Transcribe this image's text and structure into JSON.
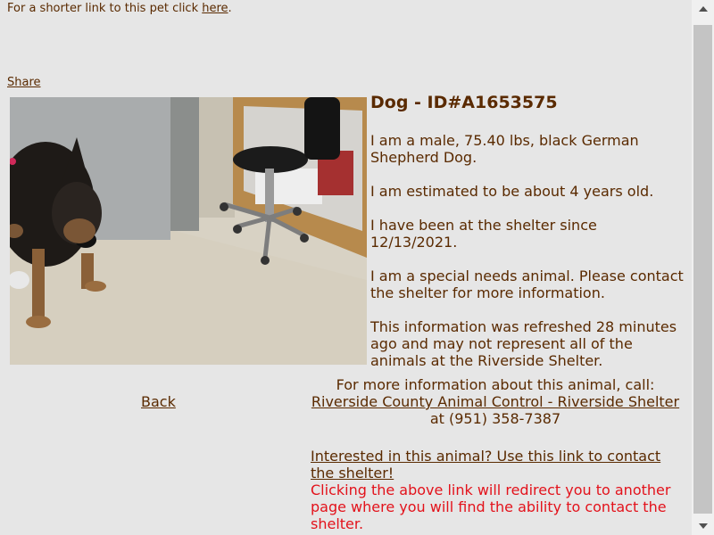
{
  "shortlink": {
    "text": "For a shorter link to this pet click ",
    "link_label": "here",
    "suffix": "."
  },
  "share_label": "Share",
  "pet": {
    "title": "Dog - ID#A1653575",
    "description": "I am a male, 75.40 lbs, black German Shepherd Dog.",
    "age": "I am estimated to be about 4 years old.",
    "since": "I have been at the shelter since 12/13/2021.",
    "special": "I am a special needs animal. Please contact the shelter for more information.",
    "refresh": "This information was refreshed 28 minutes ago and may not represent all of the animals at the Riverside Shelter."
  },
  "back_label": "Back",
  "contact": {
    "intro": "For more information about this animal, call:",
    "shelter_link": "Riverside County Animal Control - Riverside Shelter",
    "phone": " at (951) 358-7387"
  },
  "interest": {
    "link_label": "Interested in this animal? Use this link to contact the shelter!",
    "redirect_note": "Clicking the above link will redirect you to another page where you will find the ability to contact the shelter."
  },
  "colors": {
    "text": "#5a2a00",
    "warning": "#e3121b",
    "background": "#e6e6e6"
  }
}
